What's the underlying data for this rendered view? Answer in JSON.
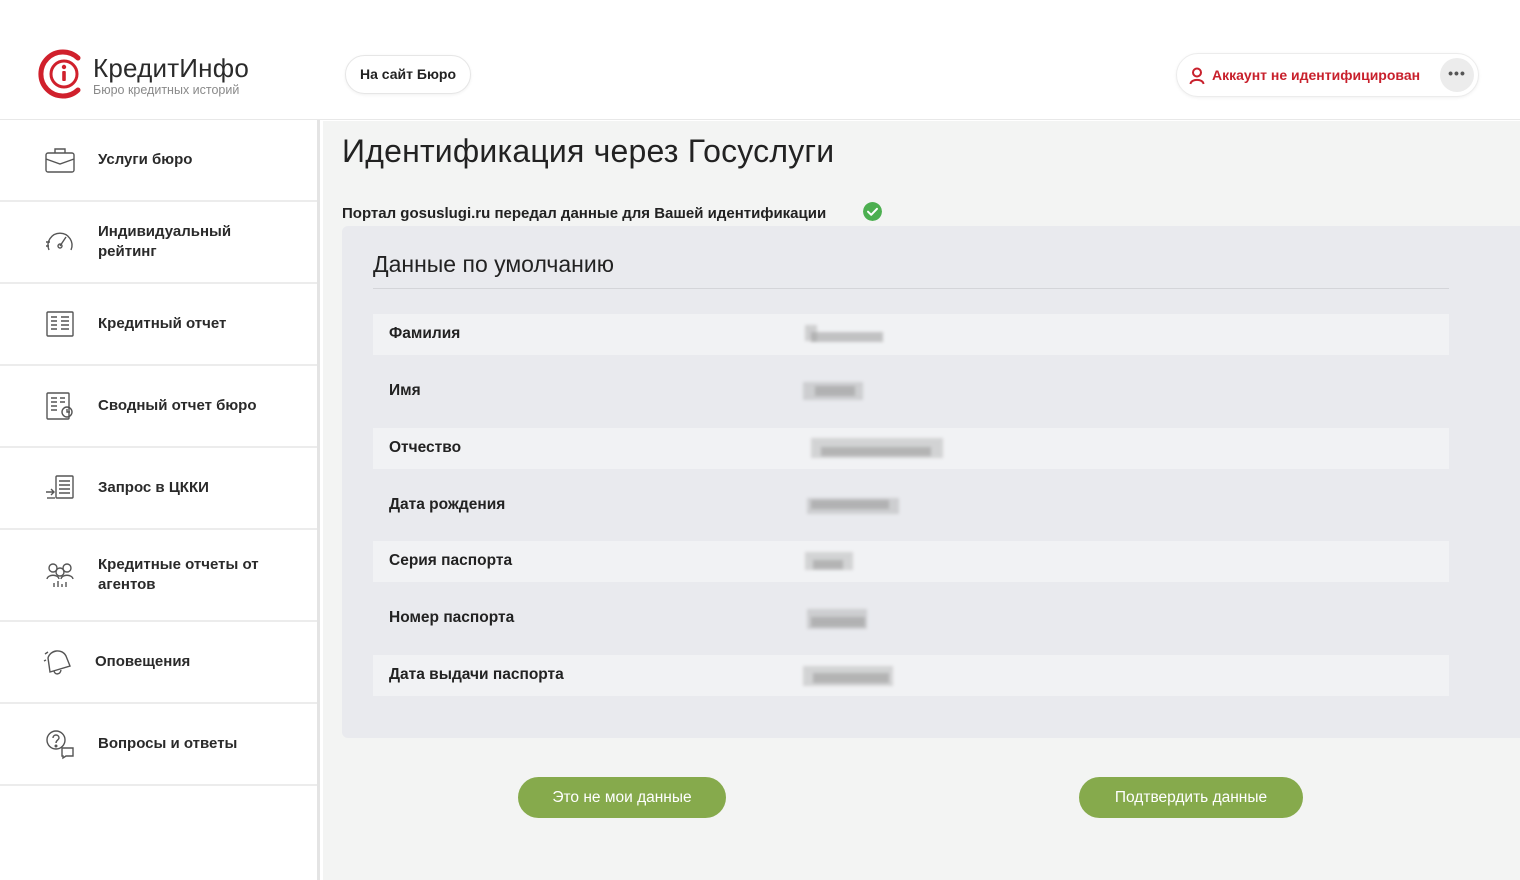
{
  "header": {
    "logo_title": "КредитИнфо",
    "logo_subtitle": "Бюро кредитных историй",
    "bureau_link": "На сайт Бюро",
    "account_status": "Аккаунт не идентифицирован",
    "more_label": "•••"
  },
  "sidebar": {
    "items": [
      {
        "label": "Услуги бюро",
        "icon": "briefcase-icon"
      },
      {
        "label": "Индивидуальный рейтинг",
        "icon": "gauge-icon"
      },
      {
        "label": "Кредитный отчет",
        "icon": "report-icon"
      },
      {
        "label": "Сводный отчет бюро",
        "icon": "summary-report-icon"
      },
      {
        "label": "Запрос в ЦККИ",
        "icon": "request-icon"
      },
      {
        "label": "Кредитные отчеты от агентов",
        "icon": "agents-icon"
      },
      {
        "label": "Оповещения",
        "icon": "bell-icon"
      },
      {
        "label": "Вопросы и ответы",
        "icon": "faq-icon"
      }
    ]
  },
  "main": {
    "title": "Идентификация через Госуслуги",
    "notice": "Портал gosuslugi.ru передал данные для Вашей идентификации",
    "panel_title": "Данные по умолчанию",
    "fields": [
      {
        "label": "Фамилия"
      },
      {
        "label": "Имя"
      },
      {
        "label": "Отчество"
      },
      {
        "label": "Дата рождения"
      },
      {
        "label": "Серия паспорта"
      },
      {
        "label": "Номер паспорта"
      },
      {
        "label": "Дата выдачи паспорта"
      }
    ],
    "reject_button": "Это не мои данные",
    "confirm_button": "Подтвердить данные"
  },
  "colors": {
    "brand_red": "#c8202c",
    "button_green": "#86aa4c",
    "check_green": "#4caf50"
  }
}
